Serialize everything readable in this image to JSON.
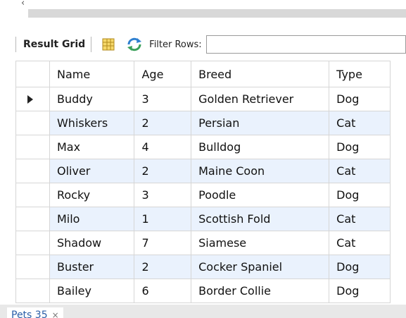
{
  "toolbar": {
    "result_grid_label": "Result Grid",
    "filter_label": "Filter Rows:",
    "filter_value": ""
  },
  "table": {
    "columns": [
      "Name",
      "Age",
      "Breed",
      "Type"
    ],
    "rows": [
      [
        "Buddy",
        "3",
        "Golden Retriever",
        "Dog"
      ],
      [
        "Whiskers",
        "2",
        "Persian",
        "Cat"
      ],
      [
        "Max",
        "4",
        "Bulldog",
        "Dog"
      ],
      [
        "Oliver",
        "2",
        "Maine Coon",
        "Cat"
      ],
      [
        "Rocky",
        "3",
        "Poodle",
        "Dog"
      ],
      [
        "Milo",
        "1",
        "Scottish Fold",
        "Cat"
      ],
      [
        "Shadow",
        "7",
        "Siamese",
        "Cat"
      ],
      [
        "Buster",
        "2",
        "Cocker Spaniel",
        "Dog"
      ],
      [
        "Bailey",
        "6",
        "Border Collie",
        "Dog"
      ]
    ],
    "selected_row": 0
  },
  "bottom_tab": {
    "label": "Pets 35",
    "close": "×"
  },
  "colors": {
    "alt_row": "#eaf2fd",
    "border": "#d6d6d6",
    "tab_text": "#2a5ea8"
  }
}
